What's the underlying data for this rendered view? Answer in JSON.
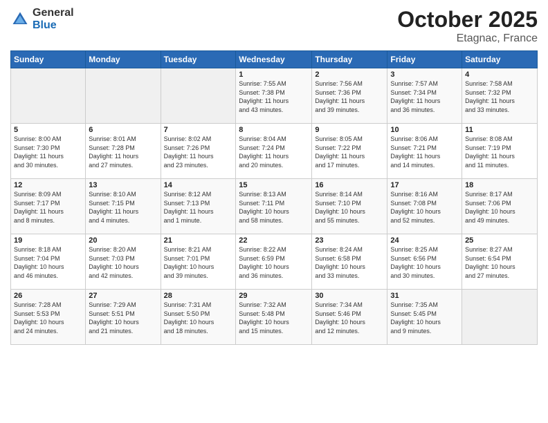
{
  "header": {
    "logo_general": "General",
    "logo_blue": "Blue",
    "month": "October 2025",
    "location": "Etagnac, France"
  },
  "weekdays": [
    "Sunday",
    "Monday",
    "Tuesday",
    "Wednesday",
    "Thursday",
    "Friday",
    "Saturday"
  ],
  "weeks": [
    [
      {
        "day": "",
        "info": ""
      },
      {
        "day": "",
        "info": ""
      },
      {
        "day": "",
        "info": ""
      },
      {
        "day": "1",
        "info": "Sunrise: 7:55 AM\nSunset: 7:38 PM\nDaylight: 11 hours\nand 43 minutes."
      },
      {
        "day": "2",
        "info": "Sunrise: 7:56 AM\nSunset: 7:36 PM\nDaylight: 11 hours\nand 39 minutes."
      },
      {
        "day": "3",
        "info": "Sunrise: 7:57 AM\nSunset: 7:34 PM\nDaylight: 11 hours\nand 36 minutes."
      },
      {
        "day": "4",
        "info": "Sunrise: 7:58 AM\nSunset: 7:32 PM\nDaylight: 11 hours\nand 33 minutes."
      }
    ],
    [
      {
        "day": "5",
        "info": "Sunrise: 8:00 AM\nSunset: 7:30 PM\nDaylight: 11 hours\nand 30 minutes."
      },
      {
        "day": "6",
        "info": "Sunrise: 8:01 AM\nSunset: 7:28 PM\nDaylight: 11 hours\nand 27 minutes."
      },
      {
        "day": "7",
        "info": "Sunrise: 8:02 AM\nSunset: 7:26 PM\nDaylight: 11 hours\nand 23 minutes."
      },
      {
        "day": "8",
        "info": "Sunrise: 8:04 AM\nSunset: 7:24 PM\nDaylight: 11 hours\nand 20 minutes."
      },
      {
        "day": "9",
        "info": "Sunrise: 8:05 AM\nSunset: 7:22 PM\nDaylight: 11 hours\nand 17 minutes."
      },
      {
        "day": "10",
        "info": "Sunrise: 8:06 AM\nSunset: 7:21 PM\nDaylight: 11 hours\nand 14 minutes."
      },
      {
        "day": "11",
        "info": "Sunrise: 8:08 AM\nSunset: 7:19 PM\nDaylight: 11 hours\nand 11 minutes."
      }
    ],
    [
      {
        "day": "12",
        "info": "Sunrise: 8:09 AM\nSunset: 7:17 PM\nDaylight: 11 hours\nand 8 minutes."
      },
      {
        "day": "13",
        "info": "Sunrise: 8:10 AM\nSunset: 7:15 PM\nDaylight: 11 hours\nand 4 minutes."
      },
      {
        "day": "14",
        "info": "Sunrise: 8:12 AM\nSunset: 7:13 PM\nDaylight: 11 hours\nand 1 minute."
      },
      {
        "day": "15",
        "info": "Sunrise: 8:13 AM\nSunset: 7:11 PM\nDaylight: 10 hours\nand 58 minutes."
      },
      {
        "day": "16",
        "info": "Sunrise: 8:14 AM\nSunset: 7:10 PM\nDaylight: 10 hours\nand 55 minutes."
      },
      {
        "day": "17",
        "info": "Sunrise: 8:16 AM\nSunset: 7:08 PM\nDaylight: 10 hours\nand 52 minutes."
      },
      {
        "day": "18",
        "info": "Sunrise: 8:17 AM\nSunset: 7:06 PM\nDaylight: 10 hours\nand 49 minutes."
      }
    ],
    [
      {
        "day": "19",
        "info": "Sunrise: 8:18 AM\nSunset: 7:04 PM\nDaylight: 10 hours\nand 46 minutes."
      },
      {
        "day": "20",
        "info": "Sunrise: 8:20 AM\nSunset: 7:03 PM\nDaylight: 10 hours\nand 42 minutes."
      },
      {
        "day": "21",
        "info": "Sunrise: 8:21 AM\nSunset: 7:01 PM\nDaylight: 10 hours\nand 39 minutes."
      },
      {
        "day": "22",
        "info": "Sunrise: 8:22 AM\nSunset: 6:59 PM\nDaylight: 10 hours\nand 36 minutes."
      },
      {
        "day": "23",
        "info": "Sunrise: 8:24 AM\nSunset: 6:58 PM\nDaylight: 10 hours\nand 33 minutes."
      },
      {
        "day": "24",
        "info": "Sunrise: 8:25 AM\nSunset: 6:56 PM\nDaylight: 10 hours\nand 30 minutes."
      },
      {
        "day": "25",
        "info": "Sunrise: 8:27 AM\nSunset: 6:54 PM\nDaylight: 10 hours\nand 27 minutes."
      }
    ],
    [
      {
        "day": "26",
        "info": "Sunrise: 7:28 AM\nSunset: 5:53 PM\nDaylight: 10 hours\nand 24 minutes."
      },
      {
        "day": "27",
        "info": "Sunrise: 7:29 AM\nSunset: 5:51 PM\nDaylight: 10 hours\nand 21 minutes."
      },
      {
        "day": "28",
        "info": "Sunrise: 7:31 AM\nSunset: 5:50 PM\nDaylight: 10 hours\nand 18 minutes."
      },
      {
        "day": "29",
        "info": "Sunrise: 7:32 AM\nSunset: 5:48 PM\nDaylight: 10 hours\nand 15 minutes."
      },
      {
        "day": "30",
        "info": "Sunrise: 7:34 AM\nSunset: 5:46 PM\nDaylight: 10 hours\nand 12 minutes."
      },
      {
        "day": "31",
        "info": "Sunrise: 7:35 AM\nSunset: 5:45 PM\nDaylight: 10 hours\nand 9 minutes."
      },
      {
        "day": "",
        "info": ""
      }
    ]
  ]
}
